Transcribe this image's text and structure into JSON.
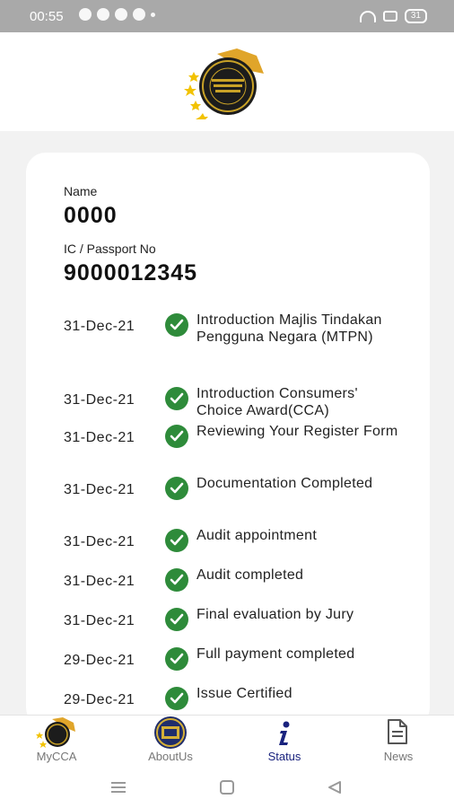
{
  "status_bar": {
    "time": "00:55",
    "battery": "31"
  },
  "profile": {
    "name_label": "Name",
    "name_value": "0000",
    "ic_label": "IC / Passport No",
    "ic_value": "9000012345"
  },
  "timeline": [
    {
      "date": "31-Dec-21",
      "text": "Introduction Majlis Tindakan Pengguna Negara (MTPN)"
    },
    {
      "date": "31-Dec-21",
      "text": "Introduction Consumers' Choice Award(CCA)"
    },
    {
      "date": "31-Dec-21",
      "text": "Reviewing Your Register Form"
    },
    {
      "date": "31-Dec-21",
      "text": "Documentation Completed"
    },
    {
      "date": "31-Dec-21",
      "text": "Audit appointment"
    },
    {
      "date": "31-Dec-21",
      "text": "Audit completed"
    },
    {
      "date": "31-Dec-21",
      "text": "Final evaluation by Jury"
    },
    {
      "date": "29-Dec-21",
      "text": "Full payment completed"
    },
    {
      "date": "29-Dec-21",
      "text": "Issue Certified"
    }
  ],
  "bottom_nav": {
    "items": [
      {
        "label": "MyCCA",
        "icon": "mycca-logo-icon"
      },
      {
        "label": "AboutUs",
        "icon": "about-us-emblem-icon"
      },
      {
        "label": "Status",
        "icon": "info-icon",
        "active": true
      },
      {
        "label": "News",
        "icon": "document-icon"
      }
    ]
  },
  "colors": {
    "check": "#2e8b3a",
    "active_nav": "#1a237e",
    "status_bar": "#a9a9a9"
  }
}
